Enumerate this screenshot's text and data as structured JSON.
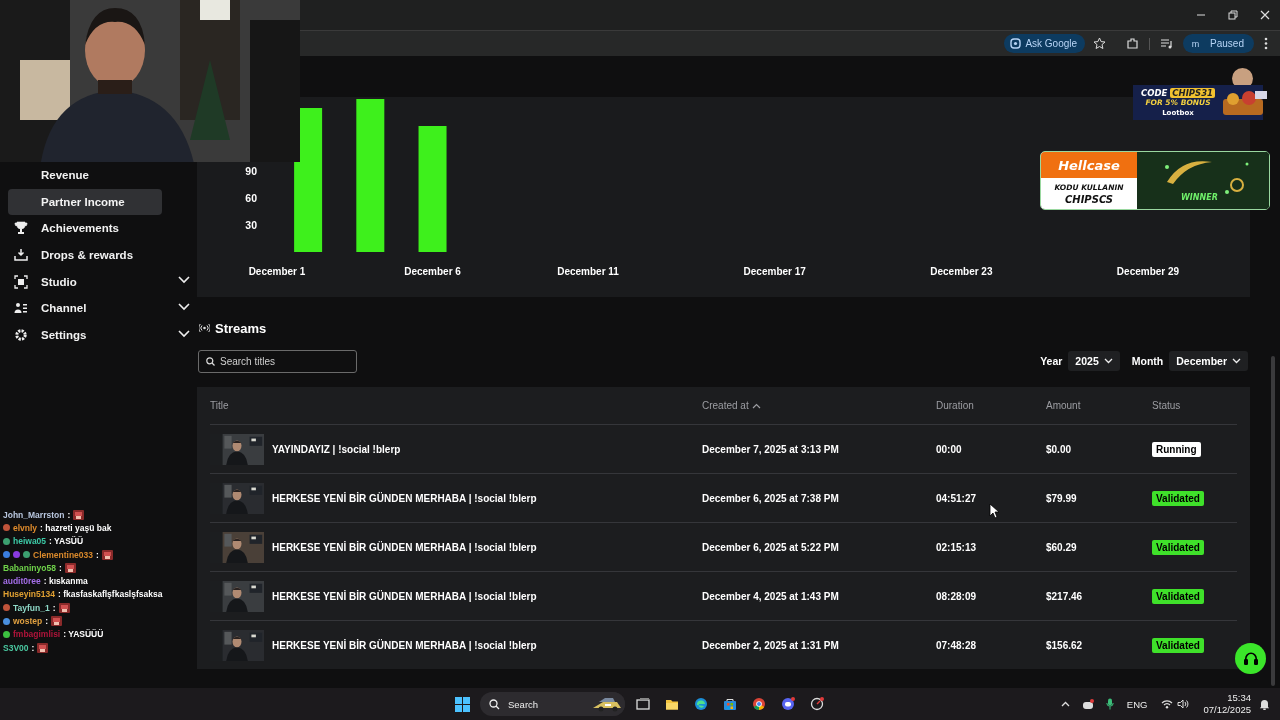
{
  "toolbar": {
    "ask_google": "Ask Google",
    "profile": {
      "initial": "m",
      "status": "Paused"
    }
  },
  "sidebar": {
    "items": [
      {
        "label": "Revenue",
        "kind": "sub",
        "selected": false
      },
      {
        "label": "Partner Income",
        "kind": "sub",
        "selected": true
      },
      {
        "label": "Achievements",
        "kind": "link",
        "selected": false
      },
      {
        "label": "Drops & rewards",
        "kind": "link",
        "selected": false
      },
      {
        "label": "Studio",
        "kind": "group",
        "selected": false,
        "expanded": false
      },
      {
        "label": "Channel",
        "kind": "group",
        "selected": false,
        "expanded": false
      },
      {
        "label": "Settings",
        "kind": "group",
        "selected": false,
        "expanded": false
      }
    ]
  },
  "chart": {
    "chart_data": {
      "type": "bar",
      "categories": [
        "December 1",
        null,
        null,
        null,
        null,
        "December 6",
        null,
        null,
        null,
        null,
        "December 11",
        null,
        null,
        null,
        null,
        null,
        "December 17",
        null,
        null,
        null,
        null,
        null,
        "December 23",
        null,
        null,
        null,
        null,
        null,
        "December 29",
        null,
        null
      ],
      "series": [
        {
          "color": "#3ef01c",
          "values": [
            null,
            160,
            null,
            170,
            null,
            140,
            null,
            null,
            null,
            null,
            null,
            null,
            null,
            null,
            null,
            null,
            null,
            null,
            null,
            null,
            null,
            null,
            null,
            null,
            null,
            null,
            null,
            null,
            null,
            null,
            null
          ]
        }
      ],
      "ylim": [
        0,
        175
      ],
      "yticks": [
        30,
        60,
        90
      ]
    }
  },
  "streams": {
    "title": "Streams",
    "search": {
      "placeholder": "Search titles"
    },
    "filters": [
      {
        "label": "Year",
        "value": "2025"
      },
      {
        "label": "Month",
        "value": "December"
      }
    ],
    "table": {
      "columns": [
        {
          "label": "Title",
          "sorted": false
        },
        {
          "label": "Created at",
          "sorted": true
        },
        {
          "label": "Duration",
          "sorted": false
        },
        {
          "label": "Amount",
          "sorted": false
        },
        {
          "label": "Status",
          "sorted": false
        }
      ],
      "rows": [
        {
          "title": "YAYINDAYIZ | !social !blerp",
          "created": "December 7, 2025 at 3:13 PM",
          "duration": "00:00",
          "amount": "$0.00",
          "status": {
            "label": "Running",
            "kind": "running"
          }
        },
        {
          "title": "HERKESE YENİ BİR GÜNDEN MERHABA | !social !blerp",
          "created": "December 6, 2025 at 7:38 PM",
          "duration": "04:51:27",
          "amount": "$79.99",
          "status": {
            "label": "Validated",
            "kind": "validated"
          }
        },
        {
          "title": "HERKESE YENİ BİR GÜNDEN MERHABA | !social !blerp",
          "created": "December 6, 2025 at 5:22 PM",
          "duration": "02:15:13",
          "amount": "$60.29",
          "status": {
            "label": "Validated",
            "kind": "validated"
          }
        },
        {
          "title": "HERKESE YENİ BİR GÜNDEN MERHABA | !social !blerp",
          "created": "December 4, 2025 at 1:43 PM",
          "duration": "08:28:09",
          "amount": "$217.46",
          "status": {
            "label": "Validated",
            "kind": "validated"
          }
        },
        {
          "title": "HERKESE YENİ BİR GÜNDEN MERHABA | !social !blerp",
          "created": "December 2, 2025 at 1:31 PM",
          "duration": "07:48:28",
          "amount": "$156.62",
          "status": {
            "label": "Validated",
            "kind": "validated"
          }
        }
      ]
    }
  },
  "chat": [
    {
      "user": "John_Marrston",
      "color": "#b9c7df",
      "message": ":",
      "emote": true
    },
    {
      "user": "elvnly",
      "color": "#e08c2c",
      "message": ": hazreti yaşü bak",
      "emote": false,
      "badges": [
        {
          "color": "#c0533a"
        }
      ]
    },
    {
      "user": "heiwa05",
      "color": "#3cc9a6",
      "message": ": YASÜÜ",
      "emote": false,
      "badges": [
        {
          "color": "#3ca070"
        }
      ]
    },
    {
      "user": "Clementine033",
      "color": "#d9892b",
      "message": ":",
      "emote": true,
      "badges": [
        {
          "color": "#3a7ee0"
        },
        {
          "color": "#8a3ae0"
        },
        {
          "color": "#3ca070"
        }
      ]
    },
    {
      "user": "Babaninyo58",
      "color": "#6fd24a",
      "message": ":",
      "emote": true
    },
    {
      "user": "audit0ree",
      "color": "#a46ee8",
      "message": ": kıskanma",
      "emote": false
    },
    {
      "user": "Huseyin5134",
      "color": "#e0a032",
      "message": ": fkasfaskaflşfkaslşfsaksa",
      "emote": false
    },
    {
      "user": "Tayfun_1",
      "color": "#8fd9c8",
      "message": ":",
      "emote": true,
      "badges": [
        {
          "color": "#c0533a"
        }
      ]
    },
    {
      "user": "wostep",
      "color": "#e0a040",
      "message": ":",
      "emote": true,
      "badges": [
        {
          "color": "#4a90e0"
        }
      ]
    },
    {
      "user": "fmbagimlisi",
      "color": "#b0143a",
      "message": ": YASÜÜÜ",
      "emote": false,
      "badges": [
        {
          "color": "#3cc040"
        }
      ]
    },
    {
      "user": "S3V00",
      "color": "#4ac8a0",
      "message": ":",
      "emote": true
    }
  ],
  "ads": {
    "lootbox": {
      "code_label": "CODE",
      "code": "CHIPS31",
      "bonus": "FOR 5% BONUS",
      "brand": "Lootbox"
    },
    "hellcase": {
      "brand": "Hellcase",
      "line": "KODU KULLANIN",
      "code": "CHIPSCS",
      "badge": "WINNER"
    }
  },
  "taskbar": {
    "search": "Search",
    "language": "ENG",
    "time": "15:34",
    "date": "07/12/2025"
  }
}
